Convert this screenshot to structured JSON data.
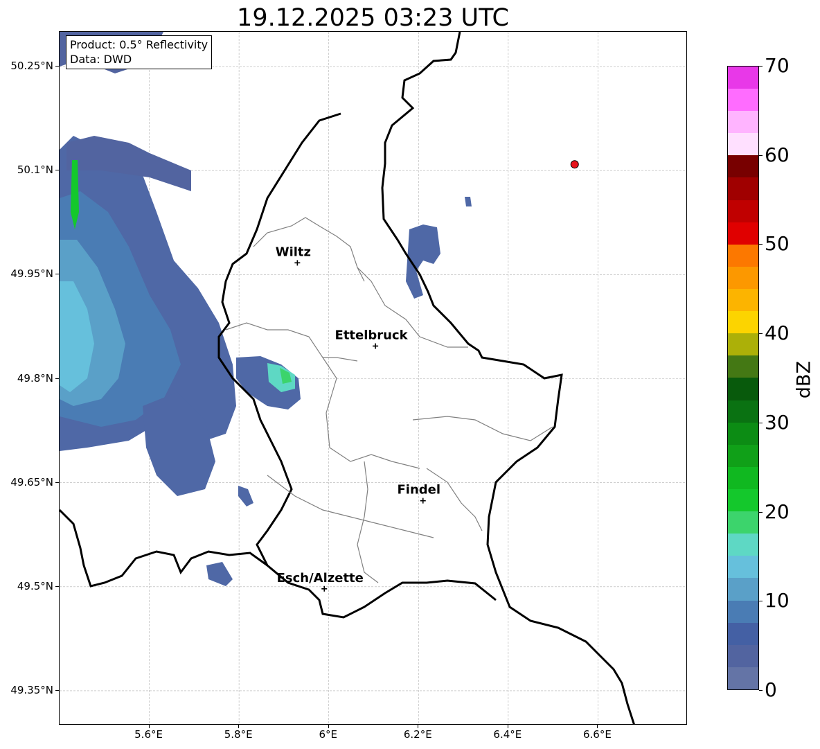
{
  "title": "19.12.2025 03:23 UTC",
  "info_box": {
    "product": "Product: 0.5° Reflectivity",
    "source": "Data: DWD"
  },
  "map": {
    "extent": {
      "lon_min": 5.4,
      "lon_max": 6.8,
      "lat_min": 49.3,
      "lat_max": 50.3
    },
    "lat_ticks": [
      {
        "value": 50.25,
        "label": "50.25°N"
      },
      {
        "value": 50.1,
        "label": "50.1°N"
      },
      {
        "value": 49.95,
        "label": "49.95°N"
      },
      {
        "value": 49.8,
        "label": "49.8°N"
      },
      {
        "value": 49.65,
        "label": "49.65°N"
      },
      {
        "value": 49.5,
        "label": "49.5°N"
      },
      {
        "value": 49.35,
        "label": "49.35°N"
      }
    ],
    "lon_ticks": [
      {
        "value": 5.6,
        "label": "5.6°E"
      },
      {
        "value": 5.8,
        "label": "5.8°E"
      },
      {
        "value": 6.0,
        "label": "6°E"
      },
      {
        "value": 6.2,
        "label": "6.2°E"
      },
      {
        "value": 6.4,
        "label": "6.4°E"
      },
      {
        "value": 6.6,
        "label": "6.6°E"
      }
    ],
    "cities": [
      {
        "name": "Wiltz",
        "lon": 5.93,
        "lat": 49.967
      },
      {
        "name": "Ettelbruck",
        "lon": 6.104,
        "lat": 49.847
      },
      {
        "name": "Findel",
        "lon": 6.21,
        "lat": 49.624
      },
      {
        "name": "Esch/Alzette",
        "lon": 5.99,
        "lat": 49.497
      }
    ],
    "radar_site": {
      "lon": 6.548,
      "lat": 50.109,
      "color": "#e8141c"
    },
    "grid_color": "#b0b0b0",
    "border_color": "#000000",
    "canton_color": "#808080"
  },
  "colorbar": {
    "label": "dBZ",
    "min": 0,
    "max": 70,
    "ticks": [
      "0",
      "10",
      "20",
      "30",
      "40",
      "50",
      "60",
      "70"
    ],
    "colors": [
      "#6474a6",
      "#5264a0",
      "#4460a4",
      "#4a7cb4",
      "#5aa0c8",
      "#66c0dc",
      "#5ed8c4",
      "#3cd46c",
      "#14c82c",
      "#10b820",
      "#10a018",
      "#0c8c14",
      "#0a7212",
      "#085a0c",
      "#447814",
      "#acb008",
      "#fcd400",
      "#fcb400",
      "#fc9800",
      "#fc7800",
      "#e00000",
      "#c00000",
      "#a00000",
      "#780000",
      "#ffe0ff",
      "#ffb4ff",
      "#ff6cff",
      "#e838e8"
    ]
  }
}
